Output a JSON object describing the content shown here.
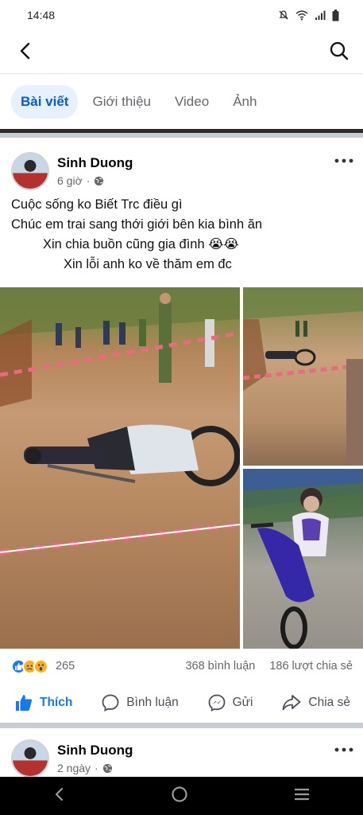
{
  "status_bar": {
    "time": "14:48"
  },
  "tabs": [
    {
      "label": "Bài viết",
      "active": true
    },
    {
      "label": "Giới thiệu",
      "active": false
    },
    {
      "label": "Video",
      "active": false
    },
    {
      "label": "Ảnh",
      "active": false
    }
  ],
  "post1": {
    "author": "Sinh Duong",
    "time": "6 giờ",
    "text_lines": [
      "Cuộc sống ko Biết Trc điều gì",
      "Chúc em trai sang thới giới bên kia bình ăn",
      "Xin chia buồn cũng gia đình 😭😭",
      "Xin lỗi anh ko về thăm em đc"
    ],
    "reaction_count": "265",
    "comments": "368 bình luận",
    "shares": "186 lượt chia sẻ"
  },
  "actions": {
    "like": "Thích",
    "comment": "Bình luận",
    "send": "Gửi",
    "share": "Chia sẻ"
  },
  "post2": {
    "author": "Sinh Duong",
    "time": "2 ngày"
  },
  "colors": {
    "accent": "#1877f2",
    "active_tab_bg": "#e7f0fd",
    "active_tab_text": "#0a5ad4"
  }
}
